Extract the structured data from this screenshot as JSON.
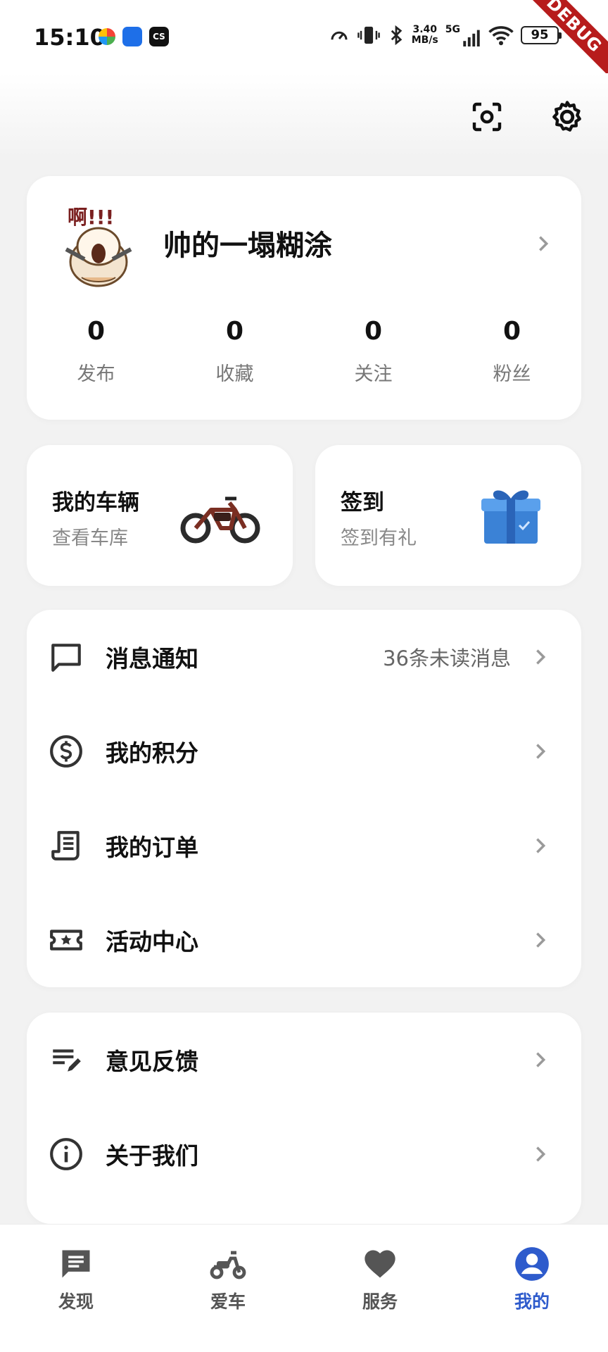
{
  "status_bar": {
    "time": "15:10",
    "net_speed_value": "3.40",
    "net_speed_unit": "MB/s",
    "network_gen": "5G",
    "battery": "95",
    "debug_banner": "DEBUG"
  },
  "profile": {
    "username": "帅的一塌糊涂",
    "stats": [
      {
        "value": "0",
        "label": "发布"
      },
      {
        "value": "0",
        "label": "收藏"
      },
      {
        "value": "0",
        "label": "关注"
      },
      {
        "value": "0",
        "label": "粉丝"
      }
    ]
  },
  "quick_cards": {
    "vehicle": {
      "title": "我的车辆",
      "subtitle": "查看车库",
      "icon": "ebike-image"
    },
    "checkin": {
      "title": "签到",
      "subtitle": "签到有礼",
      "icon": "gift-box-image"
    }
  },
  "menu_primary": [
    {
      "label": "消息通知",
      "extra": "36条未读消息",
      "icon": "message-icon"
    },
    {
      "label": "我的积分",
      "extra": "",
      "icon": "dollar-coin-icon"
    },
    {
      "label": "我的订单",
      "extra": "",
      "icon": "receipt-icon"
    },
    {
      "label": "活动中心",
      "extra": "",
      "icon": "ticket-star-icon"
    }
  ],
  "menu_secondary": [
    {
      "label": "意见反馈",
      "icon": "feedback-edit-icon"
    },
    {
      "label": "关于我们",
      "icon": "info-icon"
    }
  ],
  "tabs": [
    {
      "label": "发现",
      "icon": "chat-bubble-icon",
      "active": false
    },
    {
      "label": "爱车",
      "icon": "scooter-icon",
      "active": false
    },
    {
      "label": "服务",
      "icon": "heart-icon",
      "active": false
    },
    {
      "label": "我的",
      "icon": "user-circle-icon",
      "active": true
    }
  ],
  "colors": {
    "accent": "#2e5bcc",
    "background": "#f2f2f2",
    "debug": "#b71c1c"
  }
}
